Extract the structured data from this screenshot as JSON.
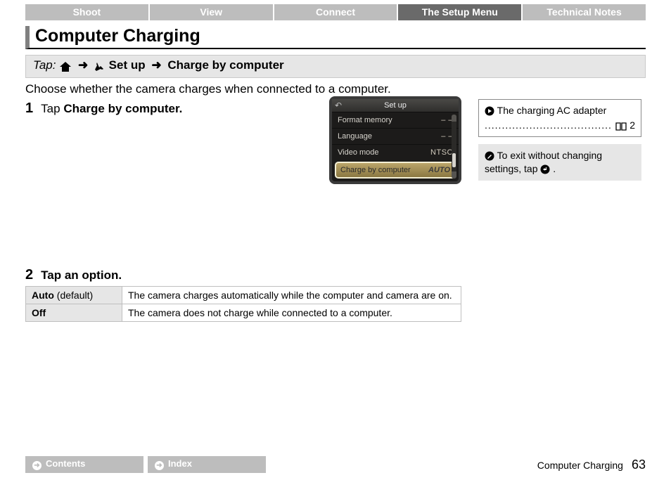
{
  "tabs": [
    "Shoot",
    "View",
    "Connect",
    "The Setup Menu",
    "Technical Notes"
  ],
  "active_tab_index": 3,
  "title": "Computer Charging",
  "crumb": {
    "prefix": "Tap:",
    "setup": "Set up",
    "target": "Charge by computer"
  },
  "intro": "Choose whether the camera charges when connected to a computer.",
  "steps": {
    "s1": {
      "n": "1",
      "lead": "Tap ",
      "bold": "Charge by computer."
    },
    "s2": {
      "n": "2",
      "text": "Tap an option."
    }
  },
  "lcd": {
    "title": "Set up",
    "rows": [
      {
        "label": "Format memory",
        "value": "– –"
      },
      {
        "label": "Language",
        "value": "– –"
      },
      {
        "label": "Video mode",
        "value": "NTSC"
      }
    ],
    "selected": {
      "label": "Charge by computer",
      "value": "AUTO"
    }
  },
  "option_table": [
    {
      "key_bold": "Auto",
      "key_plain": " (default)",
      "desc": "The camera charges automatically while the computer and camera are on."
    },
    {
      "key_bold": "Off",
      "key_plain": "",
      "desc": "The camera does not charge while connected to a computer."
    }
  ],
  "side": {
    "link_text": "The charging AC adapter",
    "page_ref": "2",
    "tip_before": "To exit without changing settings, tap ",
    "tip_after": "."
  },
  "footer": {
    "contents": "Contents",
    "index": "Index",
    "section": "Computer Charging",
    "page": "63"
  }
}
